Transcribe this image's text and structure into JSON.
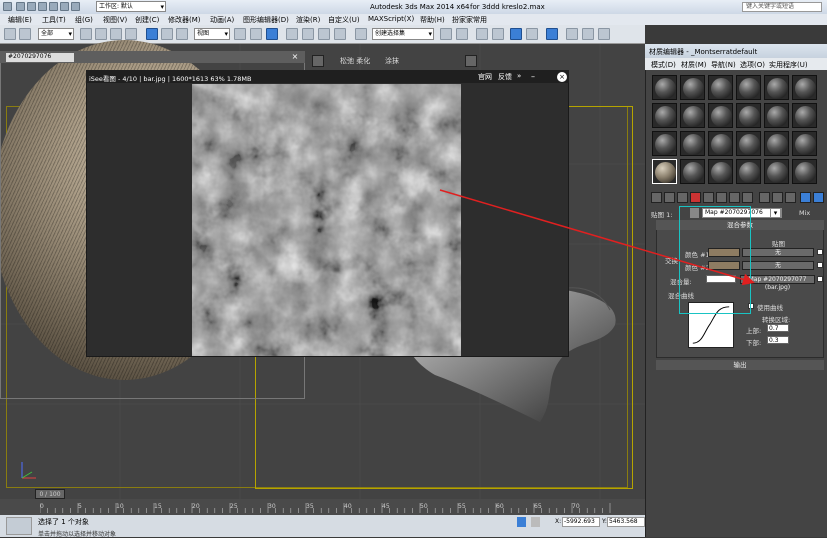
{
  "titlebar": {
    "workspace_label": "工作区: 默认",
    "app_title": "Autodesk 3ds Max  2014 x64",
    "file_title": "for 3ddd kreslo2.max",
    "search_placeholder": "键入关键字或短语"
  },
  "menu": [
    "编辑(E)",
    "工具(T)",
    "组(G)",
    "视图(V)",
    "创建(C)",
    "修改器(M)",
    "动画(A)",
    "图形编辑器(D)",
    "渲染(R)",
    "自定义(U)",
    "MAXScript(X)",
    "帮助(H)",
    "扮家家常用"
  ],
  "toolbar": {
    "selection_filter": "全部",
    "ref_coord": "视图",
    "named_selection": "创建选择集"
  },
  "subwindow": {
    "map_combo": "#2070297076",
    "close": "×"
  },
  "side_tools": {
    "brush_label": "松弛 柔化",
    "smooth_label": "涂抹"
  },
  "viewer": {
    "title": "iSee看图 - 4/10 | bar.jpg | 1600*1613  63%  1.78MB",
    "btn_official": "官网",
    "btn_feedback": "反馈",
    "btn_menu": "»",
    "btn_min": "–",
    "btn_close": "×"
  },
  "material_editor": {
    "title": "材质编辑器 - _Montserratdefault",
    "menu": [
      "模式(D)",
      "材质(M)",
      "导航(N)",
      "选项(O)",
      "实用程序(U)"
    ],
    "map_label": "贴图 1:",
    "map_name": "Map #2070297076",
    "map_type": "Mix",
    "rollout_title": "混合参数",
    "col_header": "贴图",
    "swap_label": "交换",
    "color1_label": "颜色 #1",
    "color2_label": "颜色 #2",
    "mix_amount_label": "混合量:",
    "color1_map": "无",
    "color2_map": "无",
    "mix_map": "Map #2070297077 (bar.jpg)",
    "mix_curve_label": "混合曲线",
    "use_curve_label": "使用曲线",
    "transition_label": "转换区域:",
    "upper_label": "上部:",
    "upper_value": "0.7",
    "lower_label": "下部:",
    "lower_value": "0.3",
    "output_label": "输出"
  },
  "timeline": {
    "frame_counter": "0 / 100",
    "ticks": [
      "0",
      "5",
      "10",
      "15",
      "20",
      "25",
      "30",
      "35",
      "40",
      "45",
      "50",
      "55",
      "60",
      "65",
      "70"
    ]
  },
  "status": {
    "line1": "选择了 1 个对象",
    "line2": "单击并拖动以选择并移动对象",
    "x_label": "X:",
    "x_value": "-5992.693",
    "y_label": "Y:",
    "y_value": "5463.568"
  },
  "colors": {
    "accent_blue": "#3b7fd6",
    "viewport_yellow": "#b5a400",
    "annotation_red": "#e02020",
    "teal_outline": "#19c3c3"
  }
}
